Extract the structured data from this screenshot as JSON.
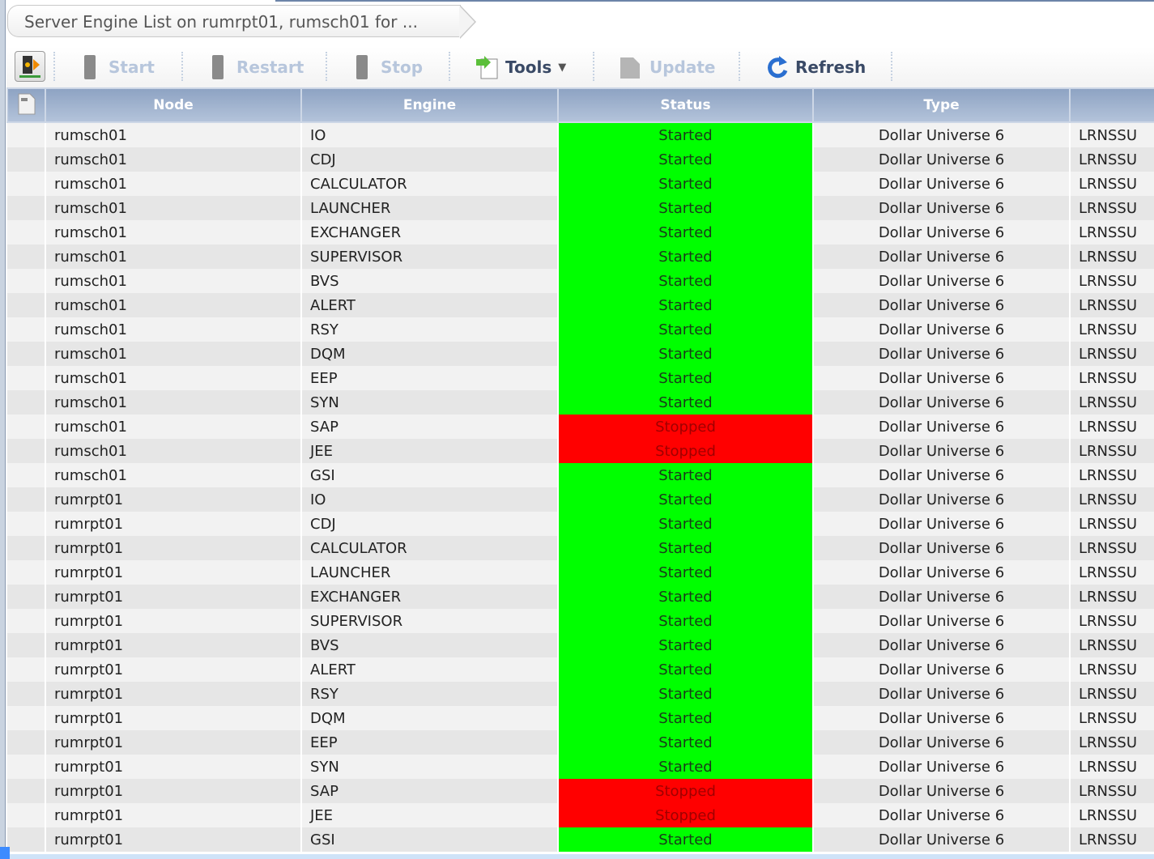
{
  "breadcrumb": "Server Engine List on rumrpt01, rumsch01 for ...",
  "toolbar": {
    "start": "Start",
    "restart": "Restart",
    "stop": "Stop",
    "tools": "Tools",
    "update": "Update",
    "refresh": "Refresh"
  },
  "columns": [
    "Node",
    "Engine",
    "Status",
    "Type",
    ""
  ],
  "colors": {
    "started": "#00ff00",
    "stopped": "#ff0000"
  },
  "rows": [
    [
      "rumsch01",
      "IO",
      "Started",
      "Dollar Universe 6",
      "LRNSSU"
    ],
    [
      "rumsch01",
      "CDJ",
      "Started",
      "Dollar Universe 6",
      "LRNSSU"
    ],
    [
      "rumsch01",
      "CALCULATOR",
      "Started",
      "Dollar Universe 6",
      "LRNSSU"
    ],
    [
      "rumsch01",
      "LAUNCHER",
      "Started",
      "Dollar Universe 6",
      "LRNSSU"
    ],
    [
      "rumsch01",
      "EXCHANGER",
      "Started",
      "Dollar Universe 6",
      "LRNSSU"
    ],
    [
      "rumsch01",
      "SUPERVISOR",
      "Started",
      "Dollar Universe 6",
      "LRNSSU"
    ],
    [
      "rumsch01",
      "BVS",
      "Started",
      "Dollar Universe 6",
      "LRNSSU"
    ],
    [
      "rumsch01",
      "ALERT",
      "Started",
      "Dollar Universe 6",
      "LRNSSU"
    ],
    [
      "rumsch01",
      "RSY",
      "Started",
      "Dollar Universe 6",
      "LRNSSU"
    ],
    [
      "rumsch01",
      "DQM",
      "Started",
      "Dollar Universe 6",
      "LRNSSU"
    ],
    [
      "rumsch01",
      "EEP",
      "Started",
      "Dollar Universe 6",
      "LRNSSU"
    ],
    [
      "rumsch01",
      "SYN",
      "Started",
      "Dollar Universe 6",
      "LRNSSU"
    ],
    [
      "rumsch01",
      "SAP",
      "Stopped",
      "Dollar Universe 6",
      "LRNSSU"
    ],
    [
      "rumsch01",
      "JEE",
      "Stopped",
      "Dollar Universe 6",
      "LRNSSU"
    ],
    [
      "rumsch01",
      "GSI",
      "Started",
      "Dollar Universe 6",
      "LRNSSU"
    ],
    [
      "rumrpt01",
      "IO",
      "Started",
      "Dollar Universe 6",
      "LRNSSU"
    ],
    [
      "rumrpt01",
      "CDJ",
      "Started",
      "Dollar Universe 6",
      "LRNSSU"
    ],
    [
      "rumrpt01",
      "CALCULATOR",
      "Started",
      "Dollar Universe 6",
      "LRNSSU"
    ],
    [
      "rumrpt01",
      "LAUNCHER",
      "Started",
      "Dollar Universe 6",
      "LRNSSU"
    ],
    [
      "rumrpt01",
      "EXCHANGER",
      "Started",
      "Dollar Universe 6",
      "LRNSSU"
    ],
    [
      "rumrpt01",
      "SUPERVISOR",
      "Started",
      "Dollar Universe 6",
      "LRNSSU"
    ],
    [
      "rumrpt01",
      "BVS",
      "Started",
      "Dollar Universe 6",
      "LRNSSU"
    ],
    [
      "rumrpt01",
      "ALERT",
      "Started",
      "Dollar Universe 6",
      "LRNSSU"
    ],
    [
      "rumrpt01",
      "RSY",
      "Started",
      "Dollar Universe 6",
      "LRNSSU"
    ],
    [
      "rumrpt01",
      "DQM",
      "Started",
      "Dollar Universe 6",
      "LRNSSU"
    ],
    [
      "rumrpt01",
      "EEP",
      "Started",
      "Dollar Universe 6",
      "LRNSSU"
    ],
    [
      "rumrpt01",
      "SYN",
      "Started",
      "Dollar Universe 6",
      "LRNSSU"
    ],
    [
      "rumrpt01",
      "SAP",
      "Stopped",
      "Dollar Universe 6",
      "LRNSSU"
    ],
    [
      "rumrpt01",
      "JEE",
      "Stopped",
      "Dollar Universe 6",
      "LRNSSU"
    ],
    [
      "rumrpt01",
      "GSI",
      "Started",
      "Dollar Universe 6",
      "LRNSSU"
    ]
  ]
}
